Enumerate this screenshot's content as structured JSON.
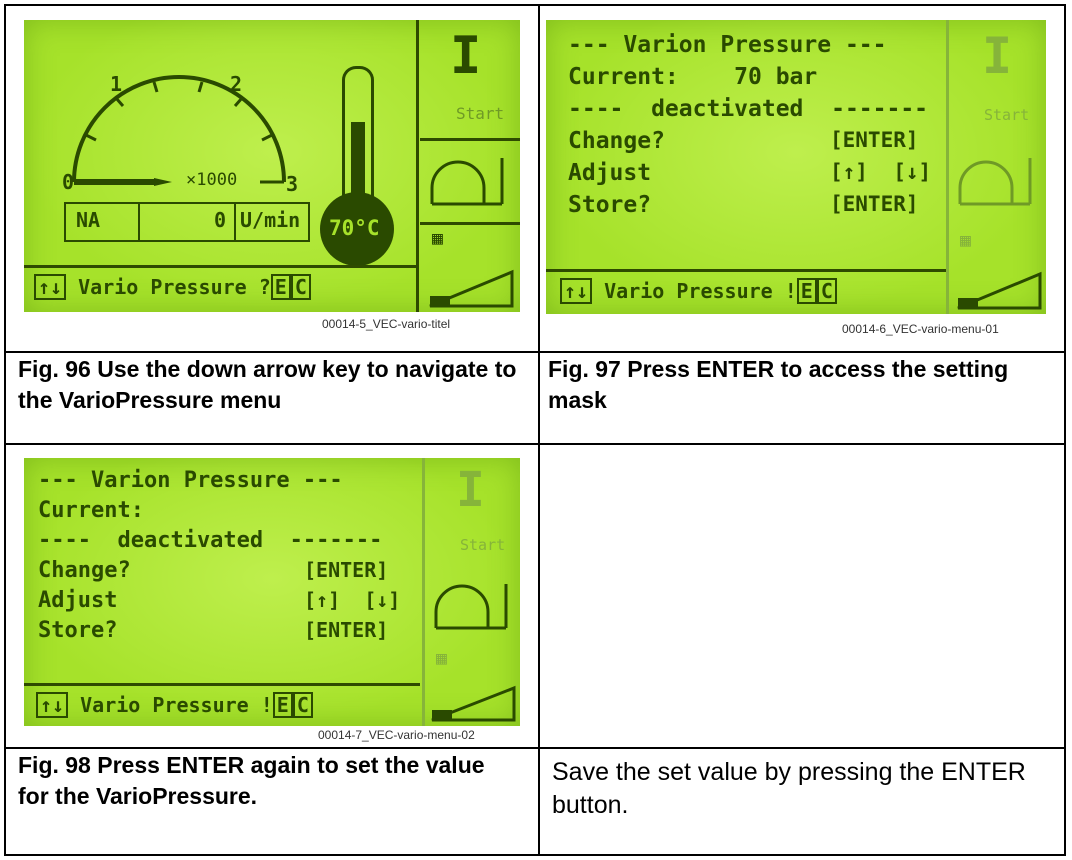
{
  "figures": [
    {
      "screen": {
        "unit": "×1000",
        "scale_labels": [
          "0",
          "1",
          "2",
          "3"
        ],
        "mode": "NA",
        "value": "0",
        "value_unit": "U/min",
        "temperature": "70°C",
        "start_label": "Start",
        "footer_arrows": "↑↓",
        "footer_text": "Vario Pressure ?",
        "footer_keys": [
          "E",
          "C"
        ]
      },
      "filename": "00014-5_VEC-vario-titel",
      "caption": "Fig. 96  Use the down arrow key to navigate to the VarioPressure menu"
    },
    {
      "screen": {
        "lines": [
          "--- Varion Pressure ---",
          "Current:    70 bar",
          "----  deactivated  -------",
          "Change?",
          "Adjust",
          "Store?"
        ],
        "right": [
          "",
          "",
          "",
          "[ENTER]",
          "[↑]  [↓]",
          "[ENTER]"
        ],
        "start_label": "Start",
        "footer_arrows": "↑↓",
        "footer_text": "Vario Pressure !",
        "footer_keys": [
          "E",
          "C"
        ]
      },
      "filename": "00014-6_VEC-vario-menu-01",
      "caption": "Fig. 97  Press ENTER to access the setting mask"
    },
    {
      "screen": {
        "lines": [
          "--- Varion Pressure ---",
          "Current:",
          "----  deactivated  -------",
          "Change?",
          "Adjust",
          "Store?"
        ],
        "right": [
          "",
          "",
          "",
          "[ENTER]",
          "[↑]  [↓]",
          "[ENTER]"
        ],
        "start_label": "Start",
        "footer_arrows": "↑↓",
        "footer_text": "Vario Pressure !",
        "footer_keys": [
          "E",
          "C"
        ]
      },
      "filename": "00014-7_VEC-vario-menu-02",
      "caption": "Fig. 98  Press ENTER again to set the value for the VarioPressure."
    }
  ],
  "note": "Save the set value by pressing the ENTER button."
}
